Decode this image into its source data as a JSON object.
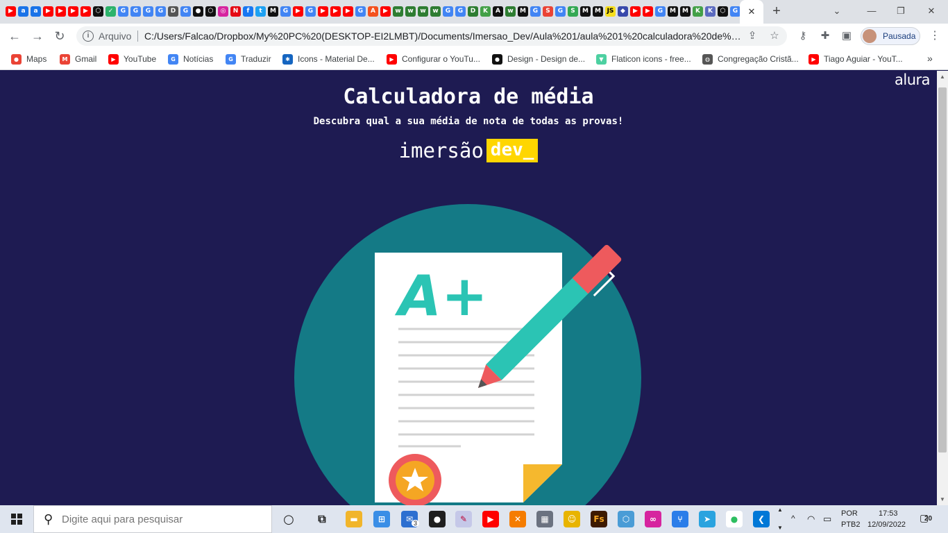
{
  "browser": {
    "pinned_tab_icons": [
      {
        "name": "youtube",
        "glyph": "▶",
        "color": "#ff0000"
      },
      {
        "name": "a-app",
        "glyph": "a",
        "color": "#1a73e8"
      },
      {
        "name": "a-app",
        "glyph": "a",
        "color": "#1a73e8"
      },
      {
        "name": "youtube",
        "glyph": "▶",
        "color": "#ff0000"
      },
      {
        "name": "youtube",
        "glyph": "▶",
        "color": "#ff0000"
      },
      {
        "name": "youtube",
        "glyph": "▶",
        "color": "#ff0000"
      },
      {
        "name": "youtube",
        "glyph": "▶",
        "color": "#ff0000"
      },
      {
        "name": "codepen",
        "glyph": "⬡",
        "color": "#111111"
      },
      {
        "name": "check",
        "glyph": "✓",
        "color": "#2db36b"
      },
      {
        "name": "google",
        "glyph": "G",
        "color": "#4285f4"
      },
      {
        "name": "google",
        "glyph": "G",
        "color": "#4285f4"
      },
      {
        "name": "google",
        "glyph": "G",
        "color": "#4285f4"
      },
      {
        "name": "google",
        "glyph": "G",
        "color": "#4285f4"
      },
      {
        "name": "dev",
        "glyph": "D",
        "color": "#555555"
      },
      {
        "name": "google",
        "glyph": "G",
        "color": "#4285f4"
      },
      {
        "name": "github",
        "glyph": "●",
        "color": "#111111"
      },
      {
        "name": "codepen",
        "glyph": "⬡",
        "color": "#111111"
      },
      {
        "name": "instagram",
        "glyph": "◎",
        "color": "#d6249f"
      },
      {
        "name": "netflix",
        "glyph": "N",
        "color": "#e50914"
      },
      {
        "name": "facebook",
        "glyph": "f",
        "color": "#1877f2"
      },
      {
        "name": "twitter",
        "glyph": "t",
        "color": "#1da1f2"
      },
      {
        "name": "medium",
        "glyph": "M",
        "color": "#111111"
      },
      {
        "name": "google",
        "glyph": "G",
        "color": "#4285f4"
      },
      {
        "name": "youtube",
        "glyph": "▶",
        "color": "#ff0000"
      },
      {
        "name": "google",
        "glyph": "G",
        "color": "#4285f4"
      },
      {
        "name": "youtube",
        "glyph": "▶",
        "color": "#ff0000"
      },
      {
        "name": "youtube",
        "glyph": "▶",
        "color": "#ff0000"
      },
      {
        "name": "youtube",
        "glyph": "▶",
        "color": "#ff0000"
      },
      {
        "name": "google",
        "glyph": "G",
        "color": "#4285f4"
      },
      {
        "name": "a-app",
        "glyph": "A",
        "color": "#f4511e"
      },
      {
        "name": "youtube",
        "glyph": "▶",
        "color": "#ff0000"
      },
      {
        "name": "w-app",
        "glyph": "w",
        "color": "#2e7d32"
      },
      {
        "name": "w-app",
        "glyph": "w",
        "color": "#2e7d32"
      },
      {
        "name": "w-app",
        "glyph": "w",
        "color": "#2e7d32"
      },
      {
        "name": "w-app",
        "glyph": "w",
        "color": "#2e7d32"
      },
      {
        "name": "google",
        "glyph": "G",
        "color": "#4285f4"
      },
      {
        "name": "google",
        "glyph": "G",
        "color": "#4285f4"
      },
      {
        "name": "dp",
        "glyph": "D",
        "color": "#2e7d32"
      },
      {
        "name": "k-app",
        "glyph": "K",
        "color": "#43a047"
      },
      {
        "name": "a-app",
        "glyph": "A",
        "color": "#111111"
      },
      {
        "name": "w-app",
        "glyph": "w",
        "color": "#2e7d32"
      },
      {
        "name": "medium",
        "glyph": "M",
        "color": "#111111"
      },
      {
        "name": "google",
        "glyph": "G",
        "color": "#4285f4"
      },
      {
        "name": "s-app",
        "glyph": "S",
        "color": "#ea4335"
      },
      {
        "name": "google",
        "glyph": "G",
        "color": "#4285f4"
      },
      {
        "name": "sheets",
        "glyph": "S",
        "color": "#34a853"
      },
      {
        "name": "medium",
        "glyph": "M",
        "color": "#111111"
      },
      {
        "name": "medium",
        "glyph": "M",
        "color": "#111111"
      },
      {
        "name": "js",
        "glyph": "JS",
        "color": "#f7df1e"
      },
      {
        "name": "diamond",
        "glyph": "◆",
        "color": "#3949ab"
      },
      {
        "name": "youtube",
        "glyph": "▶",
        "color": "#ff0000"
      },
      {
        "name": "youtube",
        "glyph": "▶",
        "color": "#ff0000"
      },
      {
        "name": "google",
        "glyph": "G",
        "color": "#4285f4"
      },
      {
        "name": "medium",
        "glyph": "M",
        "color": "#111111"
      },
      {
        "name": "medium",
        "glyph": "M",
        "color": "#111111"
      },
      {
        "name": "k-app",
        "glyph": "K",
        "color": "#43a047"
      },
      {
        "name": "k-app",
        "glyph": "K",
        "color": "#5c6bc0"
      },
      {
        "name": "codepen",
        "glyph": "⬡",
        "color": "#111111"
      },
      {
        "name": "google",
        "glyph": "G",
        "color": "#4285f4"
      },
      {
        "name": "chrome",
        "glyph": "◉",
        "color": "#555555"
      }
    ],
    "address": {
      "protocol_label": "Arquivo",
      "url": "C:/Users/Falcao/Dropbox/My%20PC%20(DESKTOP-EI2LMBT)/Documents/Imersao_Dev/Aula%201/aula%201%20calculadora%20de%20m..."
    },
    "profile_label": "Pausada",
    "bookmarks": [
      {
        "label": "Maps",
        "icon": "maps-icon",
        "glyph": "●",
        "color": "#ea4335"
      },
      {
        "label": "Gmail",
        "icon": "gmail-icon",
        "glyph": "M",
        "color": "#ea4335"
      },
      {
        "label": "YouTube",
        "icon": "youtube-icon",
        "glyph": "▶",
        "color": "#ff0000"
      },
      {
        "label": "Notícias",
        "icon": "news-icon",
        "glyph": "G",
        "color": "#4285f4"
      },
      {
        "label": "Traduzir",
        "icon": "translate-icon",
        "glyph": "G",
        "color": "#4285f4"
      },
      {
        "label": "Icons - Material De...",
        "icon": "material-icon",
        "glyph": "✱",
        "color": "#1565c0"
      },
      {
        "label": "Configurar o YouTu...",
        "icon": "youtube-icon",
        "glyph": "▶",
        "color": "#ff0000"
      },
      {
        "label": "Design - Design de...",
        "icon": "github-icon",
        "glyph": "●",
        "color": "#111111"
      },
      {
        "label": "Flaticon icons - free...",
        "icon": "flaticon-icon",
        "glyph": "▼",
        "color": "#4dd0a1"
      },
      {
        "label": "Congregação Cristã...",
        "icon": "globe-icon",
        "glyph": "◍",
        "color": "#555555"
      },
      {
        "label": "Tiago Aguiar - YouT...",
        "icon": "youtube-icon",
        "glyph": "▶",
        "color": "#ff0000"
      }
    ]
  },
  "page": {
    "brand": "alura",
    "title": "Calculadora de média",
    "subtitle": "Descubra qual a sua média de nota de todas as provas!",
    "event_word": "imersão",
    "event_badge": "dev_",
    "illustration_grade": "A+"
  },
  "colors": {
    "page_bg": "#1e1b52",
    "accent_yellow": "#ffd600",
    "circle_teal": "#147a86",
    "pencil_teal": "#2bc4b4",
    "pencil_red": "#ee5a5d",
    "seal_orange": "#f5a623"
  },
  "taskbar": {
    "search_placeholder": "Digite aqui para pesquisar",
    "mail_badge": "3",
    "lang_top": "POR",
    "lang_bottom": "PTB2",
    "time": "17:53",
    "date": "12/09/2022",
    "notification_count": "20"
  }
}
